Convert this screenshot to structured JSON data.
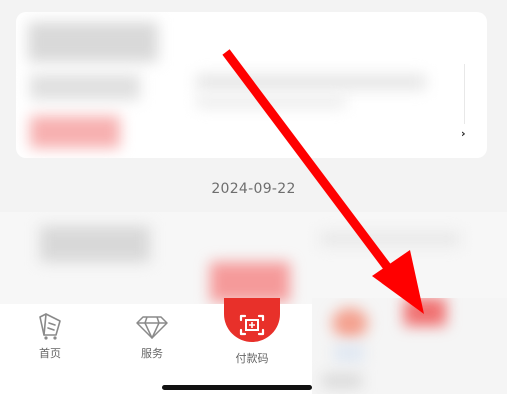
{
  "date_separator": "2024-09-22",
  "tabbar": {
    "items": [
      {
        "label": "首页",
        "icon": "home-cart-icon"
      },
      {
        "label": "服务",
        "icon": "diamond-icon"
      },
      {
        "label": "付款码",
        "icon": "payment-code-icon"
      }
    ],
    "active_color": "#e8302a"
  },
  "annotation": {
    "arrow_color": "#ff0000"
  },
  "colors": {
    "background": "#f3f3f3",
    "card": "#ffffff",
    "accent": "#e8302a"
  }
}
